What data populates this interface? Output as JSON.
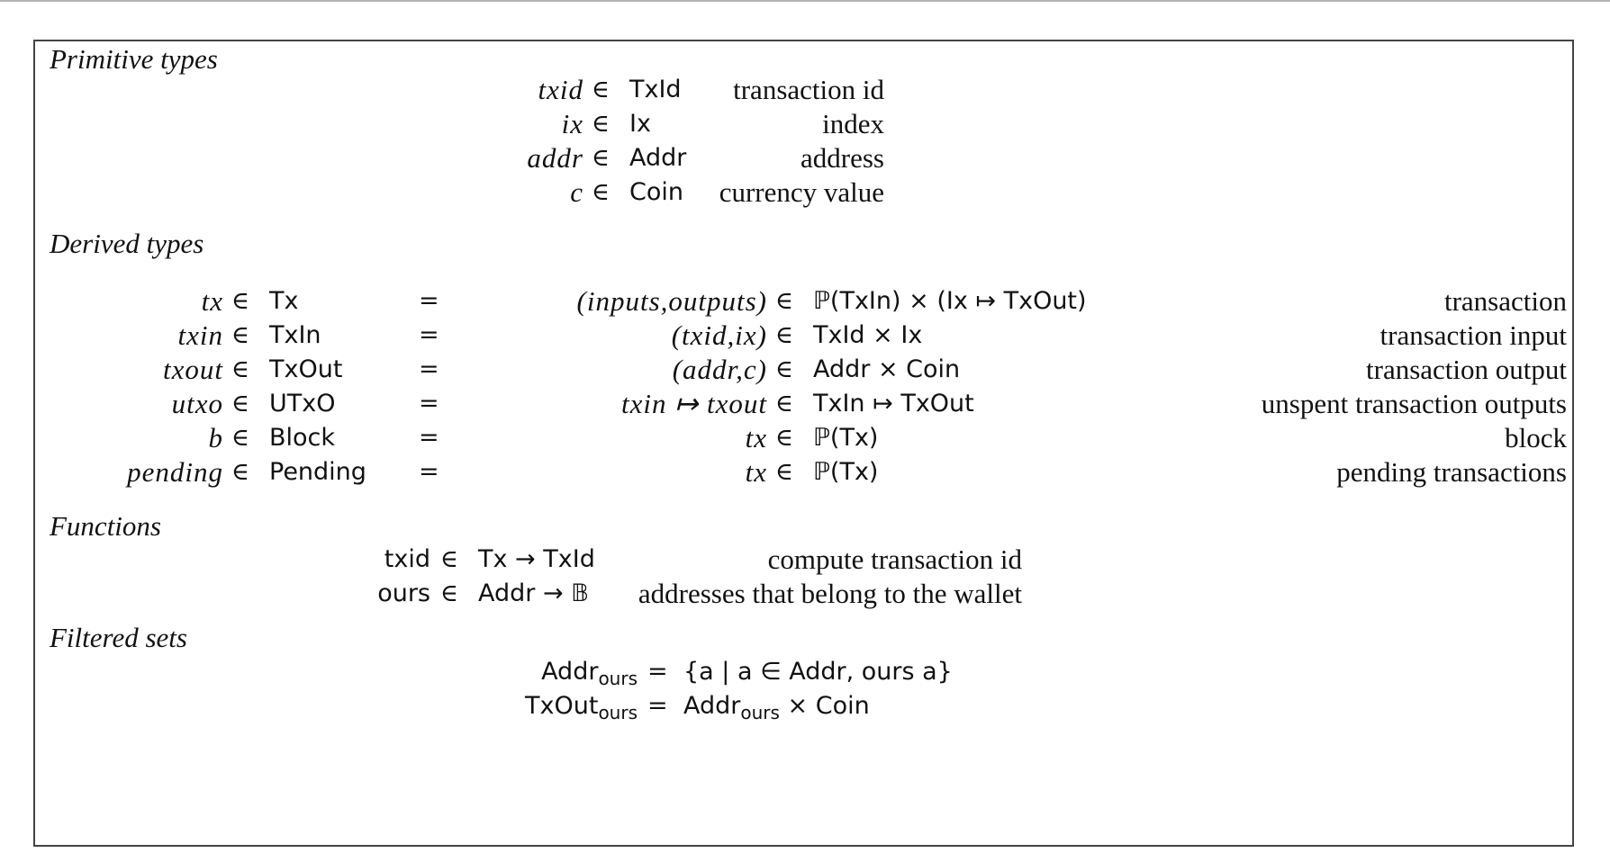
{
  "figure": {
    "sections": {
      "primitive": {
        "title": "Primitive types",
        "rows": [
          {
            "var": "txid",
            "set": "TxId",
            "desc": "transaction id"
          },
          {
            "var": "ix",
            "set": "Ix",
            "desc": "index"
          },
          {
            "var": "addr",
            "set": "Addr",
            "desc": "address"
          },
          {
            "var": "c",
            "set": "Coin",
            "desc": "currency value"
          }
        ]
      },
      "derived": {
        "title": "Derived types",
        "rows": [
          {
            "var": "tx",
            "set": "Tx",
            "eq": "=",
            "value": "(inputs,outputs)",
            "type": "ℙ(TxIn) × (Ix ↦ TxOut)",
            "desc": "transaction"
          },
          {
            "var": "txin",
            "set": "TxIn",
            "eq": "=",
            "value": "(txid,ix)",
            "type": "TxId × Ix",
            "desc": "transaction input"
          },
          {
            "var": "txout",
            "set": "TxOut",
            "eq": "=",
            "value": "(addr,c)",
            "type": "Addr × Coin",
            "desc": "transaction output"
          },
          {
            "var": "utxo",
            "set": "UTxO",
            "eq": "=",
            "value": "txin ↦ txout",
            "type": "TxIn ↦ TxOut",
            "desc": "unspent transaction outputs"
          },
          {
            "var": "b",
            "set": "Block",
            "eq": "=",
            "value": "tx",
            "type": "ℙ(Tx)",
            "desc": "block"
          },
          {
            "var": "pending",
            "set": "Pending",
            "eq": "=",
            "value": "tx",
            "type": "ℙ(Tx)",
            "desc": "pending transactions"
          }
        ]
      },
      "functions": {
        "title": "Functions",
        "rows": [
          {
            "name": "txid",
            "sig": "Tx → TxId",
            "desc": "compute transaction id"
          },
          {
            "name": "ours",
            "sig": "Addr → 𝔹",
            "desc": "addresses that belong to the wallet"
          }
        ]
      },
      "filtered": {
        "title": "Filtered sets",
        "rows": [
          {
            "lhs_base": "Addr",
            "lhs_sub": "ours",
            "eq": "=",
            "rhs": "{a | a ∈ Addr, ours a}"
          },
          {
            "lhs_base": "TxOut",
            "lhs_sub": "ours",
            "eq": "=",
            "rhs_base": "Addr",
            "rhs_sub": "ours",
            "rhs_rest": "× Coin"
          }
        ]
      }
    },
    "symbols": {
      "member": "∈",
      "equals": "="
    }
  }
}
